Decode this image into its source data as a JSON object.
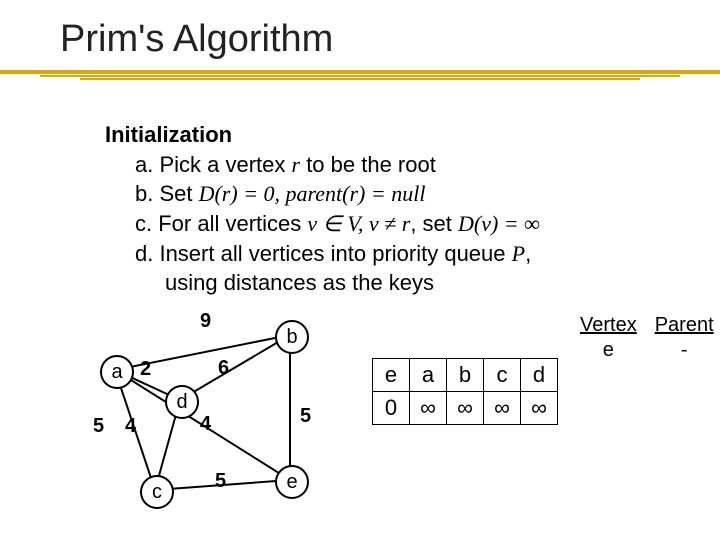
{
  "title": "Prim's Algorithm",
  "steps": {
    "heading": "Initialization",
    "a_pre": "a. Pick a vertex ",
    "a_var": "r",
    "a_post": " to be the root",
    "b_pre": "b. Set ",
    "b_mid": "D(r) = 0, parent(r) = null",
    "c_pre": "c. For all vertices ",
    "c_m1": "v ∈ V,  v ≠ r",
    "c_mid": ", set ",
    "c_m2": "D(v) = ∞",
    "d_pre": "d. Insert all vertices into priority queue ",
    "d_var": "P",
    "d_post": ",",
    "d_line2": "using distances as the keys"
  },
  "graph": {
    "vertices": {
      "a": "a",
      "b": "b",
      "c": "c",
      "d": "d",
      "e": "e"
    },
    "weights": {
      "ab": "9",
      "ad": "2",
      "ae": "5",
      "ac": "4",
      "bd": "6",
      "be": "5",
      "cd": "4",
      "ce": "5"
    }
  },
  "pq": {
    "headers": [
      "e",
      "a",
      "b",
      "c",
      "d"
    ],
    "row": [
      "0",
      "∞",
      "∞",
      "∞",
      "∞"
    ]
  },
  "vp": {
    "h1": "Vertex",
    "h2": "Parent",
    "r1c1": "e",
    "r1c2": "-"
  },
  "chart_data": {
    "type": "table",
    "title": "Prim's Algorithm initialization state",
    "graph_vertices": [
      "a",
      "b",
      "c",
      "d",
      "e"
    ],
    "graph_edges": [
      {
        "u": "a",
        "v": "b",
        "w": 9
      },
      {
        "u": "a",
        "v": "d",
        "w": 2
      },
      {
        "u": "a",
        "v": "e",
        "w": 5
      },
      {
        "u": "a",
        "v": "c",
        "w": 4
      },
      {
        "u": "b",
        "v": "d",
        "w": 6
      },
      {
        "u": "b",
        "v": "e",
        "w": 5
      },
      {
        "u": "c",
        "v": "d",
        "w": 4
      },
      {
        "u": "c",
        "v": "e",
        "w": 5
      }
    ],
    "priority_queue": {
      "e": 0,
      "a": "∞",
      "b": "∞",
      "c": "∞",
      "d": "∞"
    },
    "vertex_parent": {
      "e": "-"
    }
  }
}
